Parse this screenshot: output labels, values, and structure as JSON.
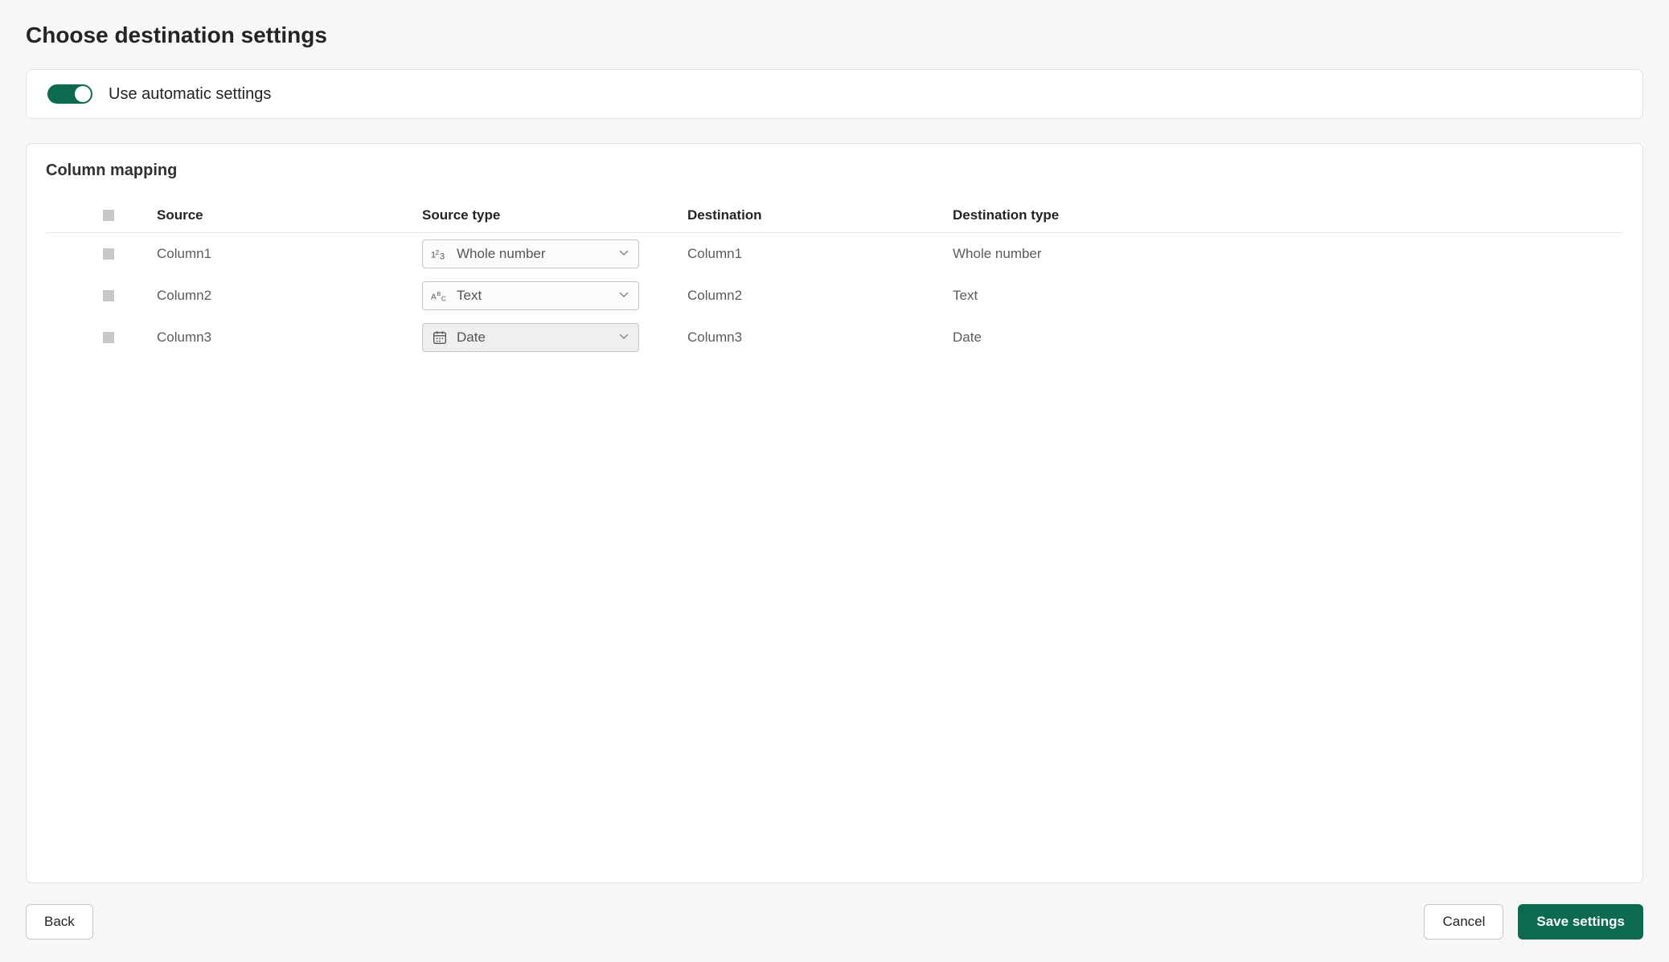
{
  "page": {
    "title": "Choose destination settings"
  },
  "toggle": {
    "label": "Use automatic settings"
  },
  "mapping": {
    "section_title": "Column mapping",
    "headers": {
      "source": "Source",
      "source_type": "Source type",
      "destination": "Destination",
      "destination_type": "Destination type"
    },
    "rows": [
      {
        "source": "Column1",
        "source_type": "Whole number",
        "source_type_icon": "number",
        "destination": "Column1",
        "destination_type": "Whole number"
      },
      {
        "source": "Column2",
        "source_type": "Text",
        "source_type_icon": "text",
        "destination": "Column2",
        "destination_type": "Text"
      },
      {
        "source": "Column3",
        "source_type": "Date",
        "source_type_icon": "date",
        "destination": "Column3",
        "destination_type": "Date"
      }
    ]
  },
  "footer": {
    "back": "Back",
    "cancel": "Cancel",
    "save": "Save settings"
  },
  "colors": {
    "accent": "#0b6a4f"
  }
}
